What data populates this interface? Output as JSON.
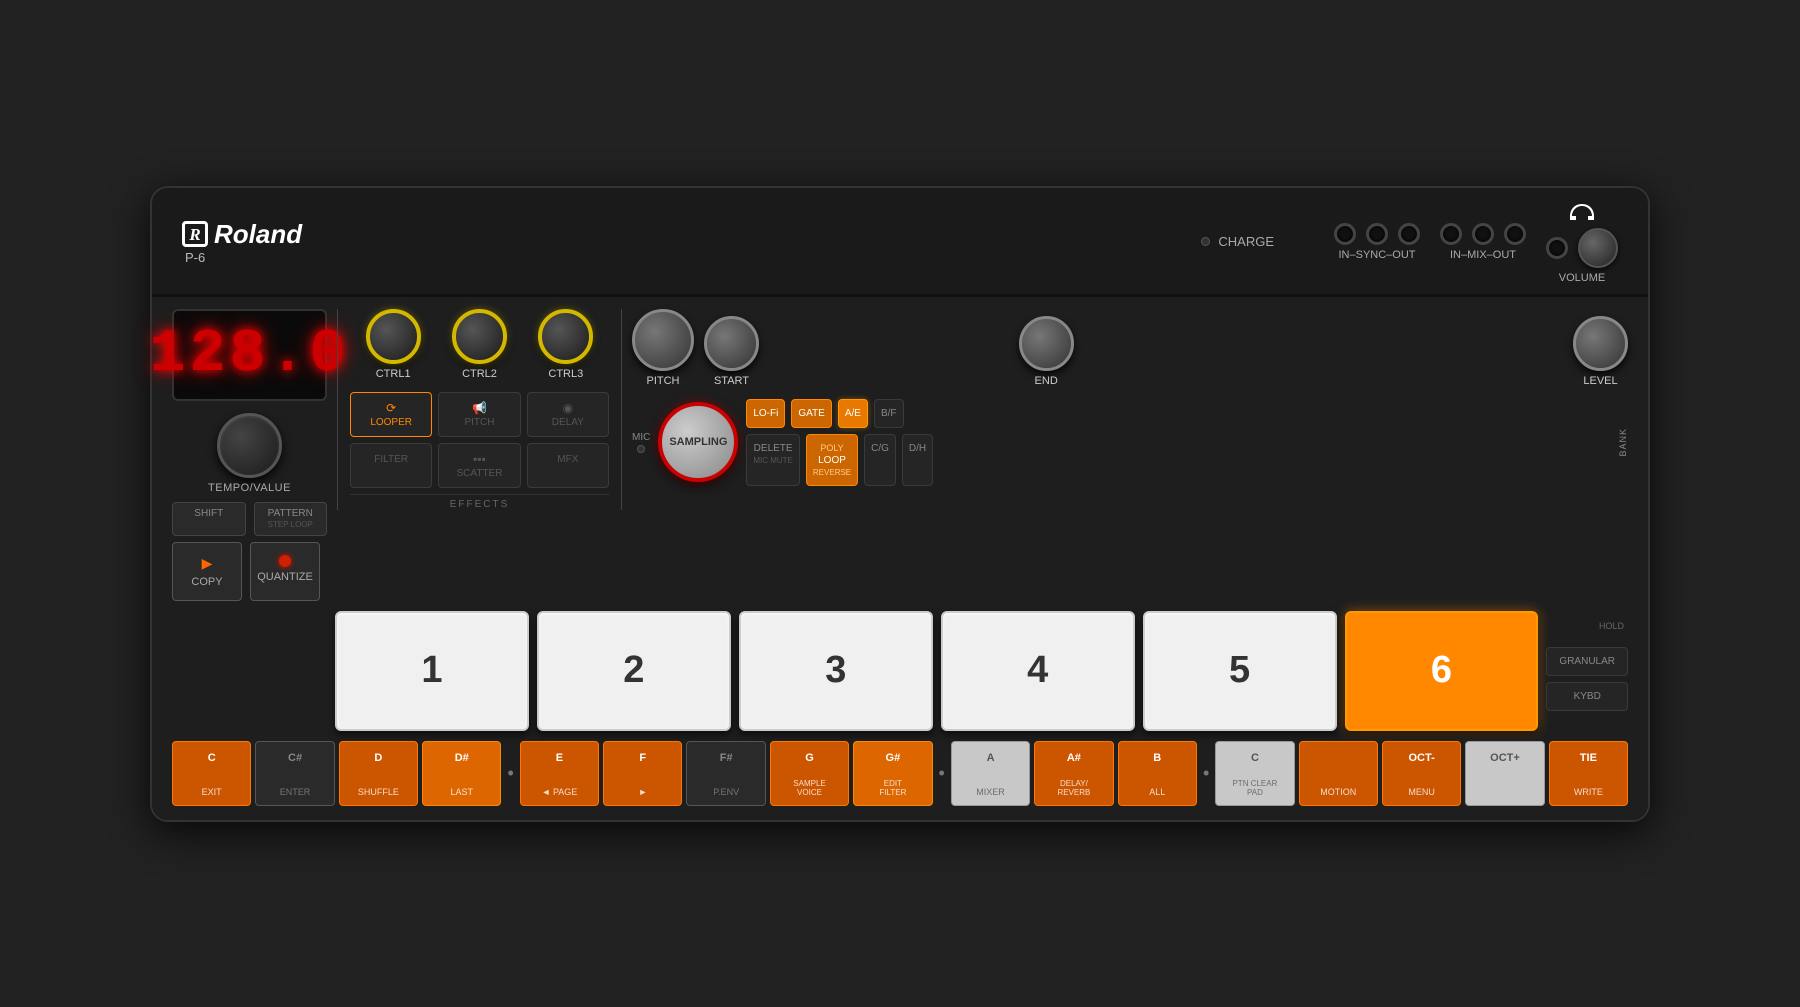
{
  "device": {
    "brand": "Roland",
    "model": "P-6",
    "display_value": "128.0",
    "top_bar": {
      "charge_label": "CHARGE",
      "connector_groups": [
        {
          "label": "IN–SYNC–OUT",
          "jacks": 3
        },
        {
          "label": "IN–MIX–OUT",
          "jacks": 3
        },
        {
          "label": "VOLUME",
          "jacks": 1
        }
      ]
    },
    "controls": {
      "ctrl_knobs": [
        {
          "id": "ctrl1",
          "label": "CTRL1"
        },
        {
          "id": "ctrl2",
          "label": "CTRL2"
        },
        {
          "id": "ctrl3",
          "label": "CTRL3"
        }
      ],
      "pitch_knobs": [
        {
          "id": "pitch",
          "label": "PITCH"
        },
        {
          "id": "start",
          "label": "START"
        },
        {
          "id": "end",
          "label": "END"
        },
        {
          "id": "level",
          "label": "LEVEL"
        }
      ],
      "tempo_label": "TEMPO/VALUE"
    },
    "effects_buttons": [
      {
        "id": "looper",
        "label": "LOOPER",
        "icon": "⟳",
        "active": true
      },
      {
        "id": "pitch",
        "label": "PITCH",
        "icon": "📢",
        "active": false
      },
      {
        "id": "delay",
        "label": "DELAY",
        "icon": "◉",
        "active": false
      },
      {
        "id": "filter",
        "label": "FILTER",
        "icon": "",
        "active": false
      },
      {
        "id": "scatter",
        "label": "SCATTER",
        "icon": "▪▪▪",
        "active": false
      },
      {
        "id": "mfx",
        "label": "MFX",
        "icon": "",
        "active": false
      }
    ],
    "effects_section_label": "EFFECTS",
    "sampling_button_label": "SAMPLING",
    "mic_label": "MIC",
    "side_buttons": [
      {
        "id": "lofi",
        "label": "LO-Fi",
        "sub": "",
        "style": "orange"
      },
      {
        "id": "gate",
        "label": "GATE",
        "sub": "",
        "style": "orange"
      },
      {
        "id": "ae",
        "label": "A/E",
        "sub": "",
        "style": "orange-bright"
      },
      {
        "id": "bf",
        "label": "B/F",
        "sub": "",
        "style": "normal"
      },
      {
        "id": "delete",
        "label": "DELETE",
        "sub": "MIC MUTE",
        "style": "normal"
      },
      {
        "id": "loop",
        "label": "LOOP",
        "sub": "POLY\nREVERSE",
        "style": "orange"
      },
      {
        "id": "cg",
        "label": "C/G",
        "sub": "",
        "style": "normal"
      },
      {
        "id": "dh",
        "label": "D/H",
        "sub": "",
        "style": "normal"
      }
    ],
    "bank_label": "BANK",
    "pads": [
      {
        "id": "pad1",
        "label": "1",
        "active": false
      },
      {
        "id": "pad2",
        "label": "2",
        "active": false
      },
      {
        "id": "pad3",
        "label": "3",
        "active": false
      },
      {
        "id": "pad4",
        "label": "4",
        "active": false
      },
      {
        "id": "pad5",
        "label": "5",
        "active": false
      },
      {
        "id": "pad6",
        "label": "6",
        "active": true
      }
    ],
    "side_func_buttons": [
      {
        "id": "granular",
        "label": "GRANULAR",
        "hold_label": ""
      },
      {
        "id": "kybd",
        "label": "KYBD",
        "hold_label": "HOLD"
      }
    ],
    "left_buttons": [
      {
        "id": "shift",
        "label": "SHIFT",
        "sub": ""
      },
      {
        "id": "pattern",
        "label": "PATTERN",
        "sub": "STEP LOOP"
      }
    ],
    "copy_btn": {
      "label": "COPY"
    },
    "quantize_btn": {
      "label": "QUANTIZE"
    },
    "piano_keys": [
      {
        "note": "C",
        "label": "EXIT",
        "style": "orange-key"
      },
      {
        "note": "C#",
        "label": "ENTER",
        "style": "black-key"
      },
      {
        "note": "D",
        "label": "SHUFFLE",
        "style": "orange-key"
      },
      {
        "note": "D#",
        "label": "LAST",
        "style": "orange-bright-key"
      },
      {
        "dot": true
      },
      {
        "note": "E",
        "label": "◄ PAGE",
        "style": "orange-key"
      },
      {
        "note": "F",
        "label": "►",
        "style": "orange-key"
      },
      {
        "note": "F#",
        "label": "P.ENV",
        "style": "black-key"
      },
      {
        "note": "G",
        "label": "SAMPLE\nVOICE",
        "style": "orange-key"
      },
      {
        "note": "G#",
        "label": "EDIT\nFILTER",
        "style": "orange-bright-key"
      },
      {
        "dot": true
      },
      {
        "note": "A",
        "label": "MIXER",
        "style": "light-key"
      },
      {
        "note": "A#",
        "label": "DELAY/\nREVERB",
        "style": "orange-key"
      },
      {
        "note": "B",
        "label": "ALL",
        "style": "orange-key"
      },
      {
        "dot": true
      },
      {
        "note": "C",
        "label": "PTN CLEAR\nPAD",
        "style": "light-key"
      },
      {
        "note": "",
        "label": "MOTION",
        "style": "orange-key"
      },
      {
        "note": "OCT-",
        "label": "MENU",
        "style": "orange-key"
      },
      {
        "note": "OCT+",
        "label": "",
        "style": "light-key"
      },
      {
        "note": "TIE",
        "label": "WRITE",
        "style": "orange-key"
      }
    ]
  }
}
